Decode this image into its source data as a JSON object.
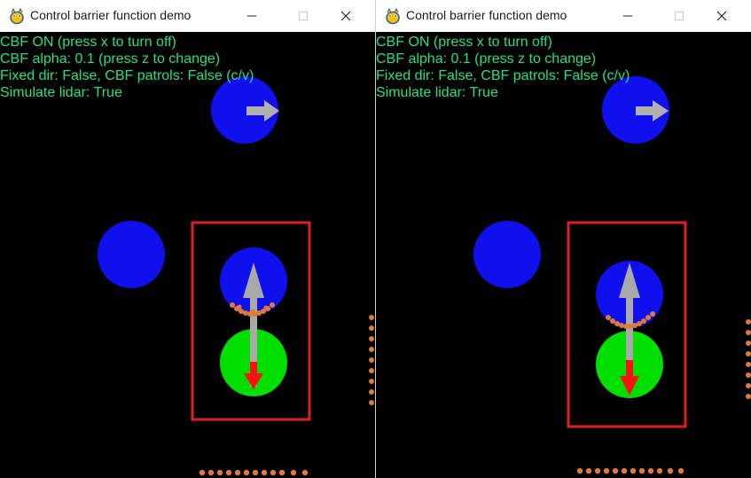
{
  "colors": {
    "hud_text": "#22e08a",
    "obstacle": "#1010ee",
    "robot": "#00e000",
    "arrow_gray": "#a9a9a9",
    "arrow_red": "#ff1010",
    "lidar_points": "#e07a3a",
    "highlight_box": "#e02020"
  },
  "windows": [
    {
      "title": "Control barrier function demo",
      "icon": "pygame-snake-icon",
      "controls": [
        "minimize-icon",
        "maximize-icon",
        "close-icon"
      ],
      "hud": [
        "CBF ON (press x to turn off)",
        "CBF alpha: 0.1 (press z to change)",
        "Fixed dir: False, CBF patrols: False (c/v)",
        "Simulate lidar: True"
      ]
    },
    {
      "title": "Control barrier function demo",
      "icon": "pygame-snake-icon",
      "controls": [
        "minimize-icon",
        "maximize-icon",
        "close-icon"
      ],
      "hud": [
        "CBF ON (press x to turn off)",
        "CBF alpha: 0.1 (press z to change)",
        "Fixed dir: False, CBF patrols: False (c/v)",
        "Simulate lidar: True"
      ]
    }
  ]
}
